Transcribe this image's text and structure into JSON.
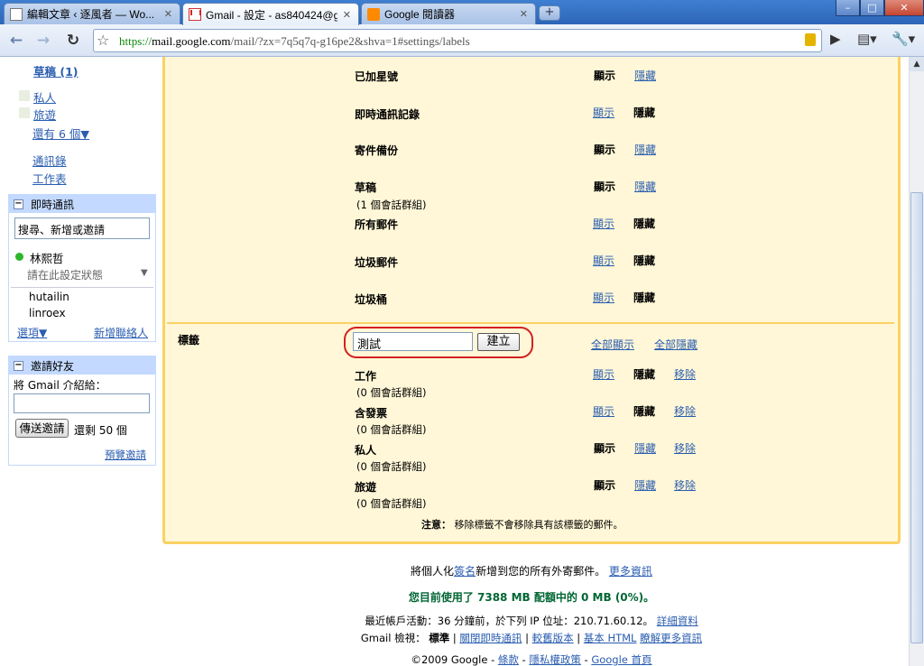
{
  "browser": {
    "tabs": [
      {
        "title": "編輯文章 ‹ 逐風者 — Wo...",
        "icon": "document-icon"
      },
      {
        "title": "Gmail - 設定 - as840424@g...",
        "icon": "gmail-icon"
      },
      {
        "title": "Google 閱讀器",
        "icon": "rss-icon"
      }
    ],
    "close_glyph": "✕",
    "new_tab_glyph": "+",
    "window_buttons": {
      "minimize": "–",
      "maximize": "□",
      "close": "✕"
    },
    "url_scheme": "https://",
    "url_host": "mail.google.com",
    "url_path": "/mail/?zx=7q5q7q-g16pe2&shva=1#settings/labels"
  },
  "sidebar": {
    "drafts": "草稿 (1)",
    "labels": [
      "私人",
      "旅遊"
    ],
    "more_labels": "還有 6 個▼",
    "contacts": "通訊錄",
    "tasks": "工作表",
    "chat": {
      "title": "即時通訊",
      "search_placeholder": "搜尋、新增或邀請",
      "user_name": "林熙哲",
      "status_text": "請在此設定狀態",
      "contacts": [
        "hutailin",
        "linroex"
      ],
      "options": "選項▼",
      "add_contact": "新增聯絡人"
    },
    "invite": {
      "title": "邀請好友",
      "label": "將 Gmail 介紹給：",
      "send_button": "傳送邀請",
      "remaining": "還剩 50 個",
      "preview": "預覽邀請"
    }
  },
  "settings": {
    "show": "顯示",
    "hide": "隱藏",
    "remove": "移除",
    "system_labels": [
      {
        "name": "已加星號",
        "state": "顯示"
      },
      {
        "name": "即時通訊記錄",
        "state": "隱藏"
      },
      {
        "name": "寄件備份",
        "state": "顯示"
      },
      {
        "name": "草稿",
        "sub": "(1 個會話群組)",
        "state": "顯示"
      },
      {
        "name": "所有郵件",
        "state": "隱藏"
      },
      {
        "name": "垃圾郵件",
        "state": "隱藏"
      },
      {
        "name": "垃圾桶",
        "state": "隱藏"
      }
    ],
    "labels_section_title": "標籤",
    "new_label_value": "測試",
    "create_button": "建立",
    "show_all": "全部顯示",
    "hide_all": "全部隱藏",
    "user_labels": [
      {
        "name": "工作",
        "sub": "(0 個會話群組)",
        "state": "隱藏"
      },
      {
        "name": "含發票",
        "sub": "(0 個會話群組)",
        "state": "隱藏"
      },
      {
        "name": "私人",
        "sub": "(0 個會話群組)",
        "state": "顯示"
      },
      {
        "name": "旅遊",
        "sub": "(0 個會話群組)",
        "state": "顯示"
      }
    ],
    "note_label": "注意：",
    "note_text": "移除標籤不會移除具有該標籤的郵件。"
  },
  "footer": {
    "sig_pre": "將個人化",
    "sig_link": "簽名",
    "sig_post": "新增到您的所有外寄郵件。",
    "more_info": "更多資訊",
    "usage": "您目前使用了 7388 MB 配額中的 0 MB (0%)。",
    "activity": "最近帳戶活動：36 分鐘前，於下列 IP 位址：210.71.60.12。",
    "details": "詳細資料",
    "view_label": "Gmail 檢視：",
    "view_standard": "標準",
    "view_chat_off": "關閉即時通訊",
    "view_old": "較舊版本",
    "view_html": "基本 HTML",
    "view_learn": "瞭解更多資訊",
    "copyright": "©2009 Google",
    "terms": "條款",
    "privacy": "隱私權政策",
    "home": "Google 首頁"
  }
}
